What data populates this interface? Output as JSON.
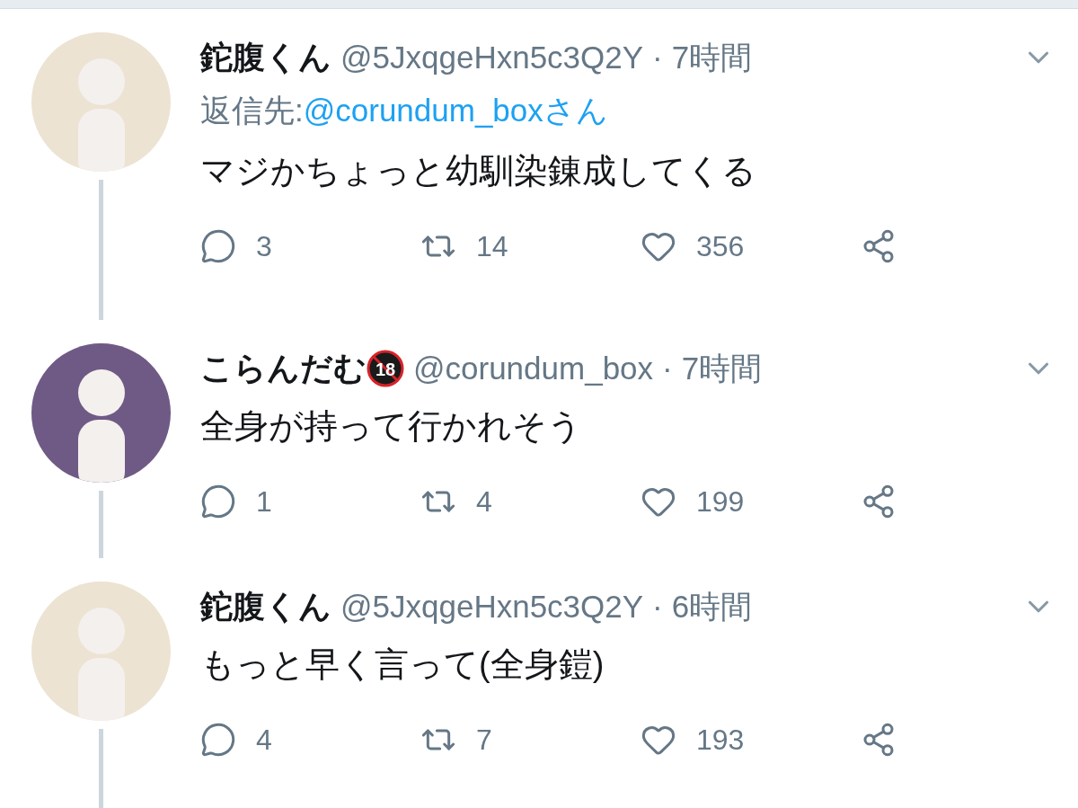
{
  "tweets": [
    {
      "name": "鉈腹くん",
      "handle": "@5JxqgeHxn5c3Q2Y",
      "separator": "·",
      "time": "7時間",
      "avatar": {
        "color": "#ece3d3"
      },
      "reply_to": {
        "label": "返信先: ",
        "link": "@corundum_boxさん"
      },
      "text": "マジかちょっと幼馴染錬成してくる",
      "connected": true,
      "actions": [
        {
          "kind": "reply",
          "count": "3"
        },
        {
          "kind": "retweet",
          "count": "14"
        },
        {
          "kind": "like",
          "count": "356"
        },
        {
          "kind": "share"
        }
      ]
    },
    {
      "name": "こらんだむ",
      "name_badge": "18",
      "handle": "@corundum_box",
      "separator": "·",
      "time": "7時間",
      "avatar": {
        "color": "#6f5a86"
      },
      "text": "全身が持って行かれそう",
      "connected": true,
      "actions": [
        {
          "kind": "reply",
          "count": "1"
        },
        {
          "kind": "retweet",
          "count": "4"
        },
        {
          "kind": "like",
          "count": "199"
        },
        {
          "kind": "share"
        }
      ]
    },
    {
      "name": "鉈腹くん",
      "handle": "@5JxqgeHxn5c3Q2Y",
      "separator": "·",
      "time": "6時間",
      "avatar": {
        "color": "#ece3d3"
      },
      "text": "もっと早く言って(全身鎧)",
      "connected": true,
      "actions": [
        {
          "kind": "reply",
          "count": "4"
        },
        {
          "kind": "retweet",
          "count": "7"
        },
        {
          "kind": "like",
          "count": "193"
        },
        {
          "kind": "share"
        }
      ]
    }
  ]
}
